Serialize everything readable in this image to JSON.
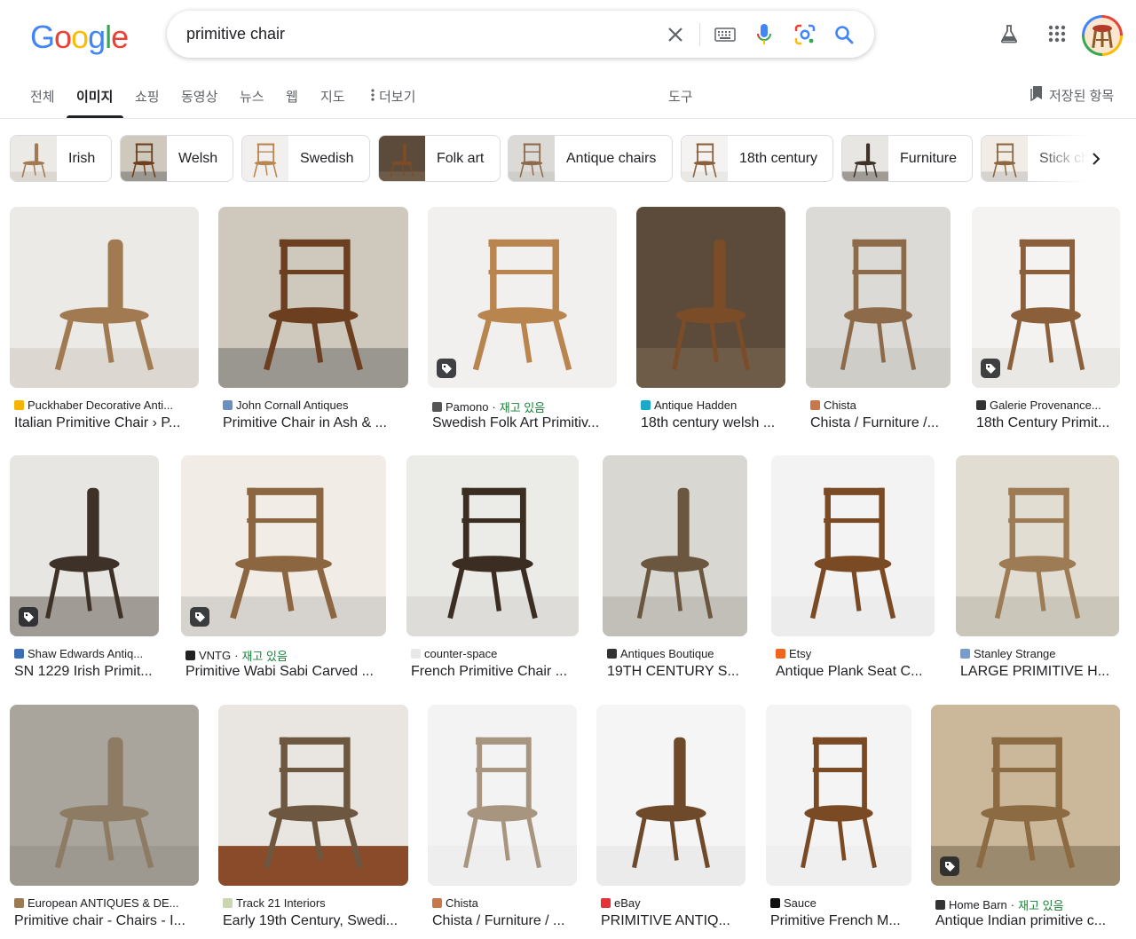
{
  "header": {
    "logo": [
      "G",
      "o",
      "o",
      "g",
      "l",
      "e"
    ],
    "logo_colors": [
      "#4285f4",
      "#ea4335",
      "#fbbc05",
      "#4285f4",
      "#34a853",
      "#ea4335"
    ],
    "query": "primitive chair",
    "icons": [
      "close-icon",
      "keyboard-icon",
      "mic-icon",
      "lens-icon",
      "search-icon",
      "labs-icon",
      "apps-icon"
    ]
  },
  "tabs": {
    "items": [
      "전체",
      "이미지",
      "쇼핑",
      "동영상",
      "뉴스",
      "웹",
      "지도",
      "더보기"
    ],
    "active": "이미지",
    "tools": "도구",
    "saved": "저장된 항목"
  },
  "chips": [
    "Irish",
    "Welsh",
    "Swedish",
    "Folk art",
    "Antique chairs",
    "18th century",
    "Furniture",
    "Stick chairs"
  ],
  "results": [
    {
      "source": "Puckhaber Decorative Anti...",
      "title": "Italian Primitive Chair › P...",
      "fav_color": "#f6b400",
      "stock": "",
      "tag": false
    },
    {
      "source": "John Cornall Antiques",
      "title": "Primitive Chair in Ash & ...",
      "fav_color": "#6b8fbf",
      "stock": "",
      "tag": false
    },
    {
      "source": "Pamono",
      "title": "Swedish Folk Art Primitiv...",
      "fav_color": "#555555",
      "stock": "재고 있음",
      "tag": true
    },
    {
      "source": "Antique Hadden",
      "title": "18th century welsh ...",
      "fav_color": "#1aa9c8",
      "stock": "",
      "tag": false
    },
    {
      "source": "Chista",
      "title": "Chista / Furniture /...",
      "fav_color": "#c7774a",
      "stock": "",
      "tag": false
    },
    {
      "source": "Galerie Provenance...",
      "title": "18th Century Primit...",
      "fav_color": "#333333",
      "stock": "",
      "tag": true
    },
    {
      "source": "Shaw Edwards Antiq...",
      "title": "SN 1229 Irish Primit...",
      "fav_color": "#3a6fb5",
      "stock": "",
      "tag": true
    },
    {
      "source": "VNTG",
      "title": "Primitive Wabi Sabi Carved ...",
      "fav_color": "#222222",
      "stock": "재고 있음",
      "tag": true
    },
    {
      "source": "counter-space",
      "title": "French Primitive Chair ...",
      "fav_color": "#e8e8e8",
      "stock": "",
      "tag": false
    },
    {
      "source": "Antiques Boutique",
      "title": "19TH CENTURY S...",
      "fav_color": "#333333",
      "stock": "",
      "tag": false
    },
    {
      "source": "Etsy",
      "title": "Antique Plank Seat C...",
      "fav_color": "#f1641e",
      "stock": "",
      "tag": false
    },
    {
      "source": "Stanley Strange",
      "title": "LARGE PRIMITIVE H...",
      "fav_color": "#7b9cc9",
      "stock": "",
      "tag": false
    },
    {
      "source": "European ANTIQUES & DE...",
      "title": "Primitive chair - Chairs - I...",
      "fav_color": "#9c7b52",
      "stock": "",
      "tag": false
    },
    {
      "source": "Track 21 Interiors",
      "title": "Early 19th Century, Swedi...",
      "fav_color": "#c9d6b0",
      "stock": "",
      "tag": false
    },
    {
      "source": "Chista",
      "title": "Chista / Furniture / ...",
      "fav_color": "#c7774a",
      "stock": "",
      "tag": false
    },
    {
      "source": "eBay",
      "title": "PRIMITIVE ANTIQ...",
      "fav_color": "#e53238",
      "stock": "",
      "tag": false
    },
    {
      "source": "Sauce",
      "title": "Primitive French M...",
      "fav_color": "#111111",
      "stock": "",
      "tag": false
    },
    {
      "source": "Home Barn",
      "title": "Antique Indian primitive c...",
      "fav_color": "#333333",
      "stock": "재고 있음",
      "tag": true
    }
  ]
}
